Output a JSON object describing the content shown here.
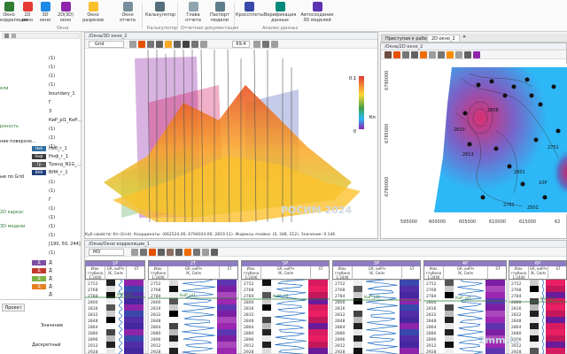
{
  "ribbon": {
    "buttons": [
      {
        "label": "Окно корреляции",
        "x_icon": "correlation-icon"
      },
      {
        "label": "2D окно",
        "x_icon": "map-2d-icon"
      },
      {
        "label": "3D окно",
        "x_icon": "cube-3d-icon"
      },
      {
        "label": "2D(3D) окно",
        "x_icon": "window-icon"
      },
      {
        "label": "Окно разрезов",
        "x_icon": "section-icon"
      },
      {
        "label": "Окно отчета",
        "x_icon": "report-icon"
      },
      {
        "label": "Калькулятор",
        "x_icon": "calculator-icon"
      },
      {
        "label": "Главa отчета",
        "x_icon": "report-chapter-icon"
      },
      {
        "label": "Паспорт модели",
        "x_icon": "passport-icon"
      },
      {
        "label": "Кроссплоты",
        "x_icon": "crossplot-icon"
      },
      {
        "label": "Верификация данных",
        "x_icon": "verify-icon"
      },
      {
        "label": "Автосоздание 3D моделей",
        "x_icon": "auto3d-icon"
      }
    ],
    "groups": [
      "Окна",
      "Калькулятор",
      "Отчетная документация",
      "Анализ данных"
    ]
  },
  "tree": {
    "items": [
      {
        "label": "(1)"
      },
      {
        "label": "(1)"
      },
      {
        "label": "(1)"
      },
      {
        "label": "(1)"
      },
      {
        "label": "boundary_1"
      },
      {
        "label": "Г"
      },
      {
        "label": "3"
      },
      {
        "label": "КиР_pl1_КиР..."
      },
      {
        "label": "(1)"
      },
      {
        "label": "(1)"
      },
      {
        "label": "(1)"
      },
      {
        "label": "Ноб_г_1"
      },
      {
        "label": "Ннф_г_1"
      },
      {
        "label": "Тренд_N1G_..."
      },
      {
        "label": "ВНК_г_1"
      },
      {
        "label": "(1)"
      },
      {
        "label": "(1)"
      },
      {
        "label": "Г"
      },
      {
        "label": "(1)"
      },
      {
        "label": "(1)"
      },
      {
        "label": "(1)"
      },
      {
        "label": "(1)"
      },
      {
        "label": "[190, 50, 244]"
      },
      {
        "label": "(1)"
      },
      {
        "label": "Д"
      },
      {
        "label": "Д"
      },
      {
        "label": "Д"
      },
      {
        "label": "Д"
      },
      {
        "label": "Д"
      }
    ],
    "left_labels": [
      {
        "label": "ели"
      },
      {
        "label": "рхность"
      },
      {
        "label": "ние поверхно..."
      },
      {
        "label": "ые по Grid"
      },
      {
        "label": "2D каркас"
      },
      {
        "label": "3D модели"
      }
    ],
    "tags": [
      {
        "label": "Ноб",
        "color": "#2f6e9e"
      },
      {
        "label": "Ннф",
        "color": "#3b3b3b"
      },
      {
        "label": "Тр",
        "color": "#5a5a5a"
      },
      {
        "label": "ВНК",
        "color": "#1f3f7a"
      }
    ],
    "tags2": [
      {
        "label": "Д",
        "color": "#7b4ea3"
      },
      {
        "label": "Д",
        "color": "#c0392b"
      },
      {
        "label": "Д",
        "color": "#7cb342"
      },
      {
        "label": "Д",
        "color": "#e67e22"
      }
    ]
  },
  "bottom_panel": {
    "tab": "Проект",
    "col_header": "Значение",
    "row": "Дискретный"
  },
  "win3d": {
    "title": "/Окна/3D окно_2",
    "dropdown": "Grid",
    "zoom": "69.4",
    "legend_max": "0.1",
    "legend_min": "0",
    "legend_label": "Кп",
    "watermark": "РОСИМ 2024",
    "status": "Куб свойств: Кп (Grid). Координаты: (662524.00, 6794024.00, 2819.11). Индексы ячейки: (0, 348, 212). Значение: 0.146"
  },
  "win2d": {
    "tabs": [
      "Приступая к работе",
      "2D окно_2"
    ],
    "title": "/Окна/2D окно_2",
    "y_ticks": [
      "6790000",
      "6785000",
      "6780000"
    ],
    "x_ticks": [
      "595000",
      "600000",
      "605000",
      "610000",
      "615000",
      "62"
    ],
    "well_labels": [
      "2810",
      "2813",
      "2761",
      "2801",
      "10P",
      "2501",
      "2808",
      "2751"
    ]
  },
  "corr": {
    "title": "/Окна/Окно корреляции_1",
    "dropdown": "MD",
    "wells": [
      "1P",
      "2T",
      "5P",
      "3P",
      "4P",
      "6P"
    ],
    "depths": [
      "2752",
      "2768",
      "2784",
      "2800",
      "2816",
      "2832",
      "2848",
      "2864",
      "2880",
      "2896",
      "2912",
      "2928"
    ],
    "subheader": "Изм. глубина",
    "scale": "1:2446",
    "curve_label": "GR, киР/ч",
    "ik_label": "IK, См/м",
    "st_label": "ST",
    "formation": "КиР_pl1",
    "watermark": "2mm.iu"
  }
}
